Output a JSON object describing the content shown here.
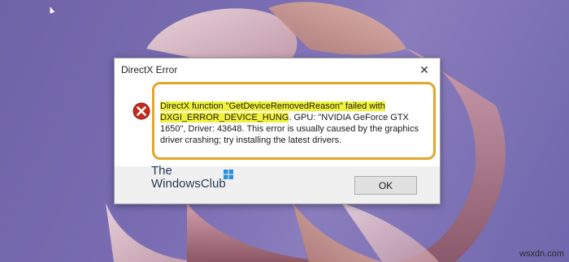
{
  "dialog": {
    "title": "DirectX Error",
    "close_glyph": "✕",
    "message_highlight_1": "DirectX function \"GetDeviceRemovedReason\" failed with",
    "message_highlight_2": "DXGI_ERROR_DEVICE_HUNG",
    "message_rest_1": ". GPU: \"NVIDIA GeForce GTX 1650\",",
    "message_rest_2": "Driver: 43648. This error is usually caused by the graphics driver crashing; try installing the latest drivers.",
    "ok_label": "OK",
    "icon": "error-x-icon",
    "icon_color": "#c42b1c",
    "highlight_box_color": "#e1a62a"
  },
  "watermark": {
    "line1": "The",
    "line2": "WindowsClub"
  },
  "site_watermark": "wsxdn.com",
  "colors": {
    "wallpaper": "#7466ad",
    "highlight": "#f2f23a"
  }
}
